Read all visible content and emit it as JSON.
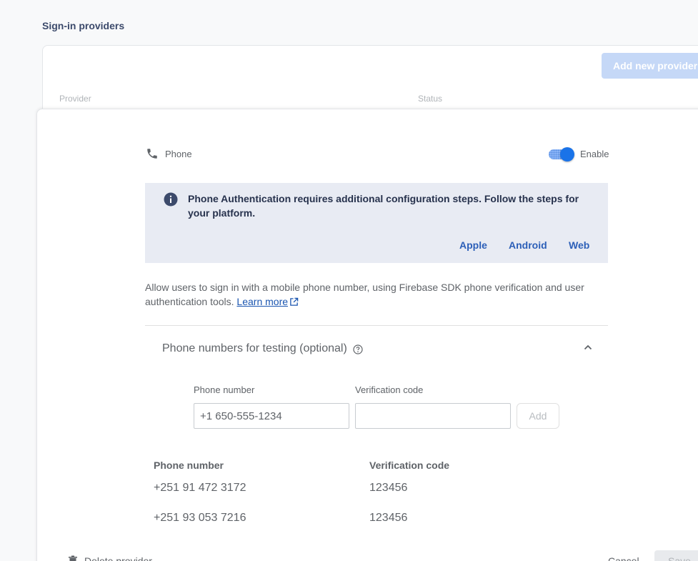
{
  "section": {
    "title": "Sign-in providers"
  },
  "providers_table": {
    "add_button": "Add new provider",
    "columns": [
      "Provider",
      "Status"
    ]
  },
  "panel": {
    "provider_name": "Phone",
    "provider_icon": "phone-icon",
    "enable_label": "Enable",
    "enabled": true,
    "info": {
      "text": "Phone Authentication requires additional configuration steps. Follow the steps for your platform.",
      "links": [
        "Apple",
        "Android",
        "Web"
      ]
    },
    "description": "Allow users to sign in with a mobile phone number, using Firebase SDK phone verification and user authentication tools.",
    "learn_more": "Learn more",
    "testing": {
      "title": "Phone numbers for testing (optional)",
      "phone_label": "Phone number",
      "code_label": "Verification code",
      "phone_placeholder": "+1 650-555-1234",
      "code_value": "",
      "add_button": "Add",
      "table_headers": [
        "Phone number",
        "Verification code"
      ],
      "rows": [
        {
          "phone": "+251 91 472 3172",
          "code": "123456"
        },
        {
          "phone": "+251 93 053 7216",
          "code": "123456"
        }
      ]
    },
    "footer": {
      "delete": "Delete provider",
      "cancel": "Cancel",
      "save": "Save"
    }
  },
  "colors": {
    "accent": "#1a73e8",
    "info_bg": "#e8ebf3",
    "link": "#2c5fb8"
  }
}
